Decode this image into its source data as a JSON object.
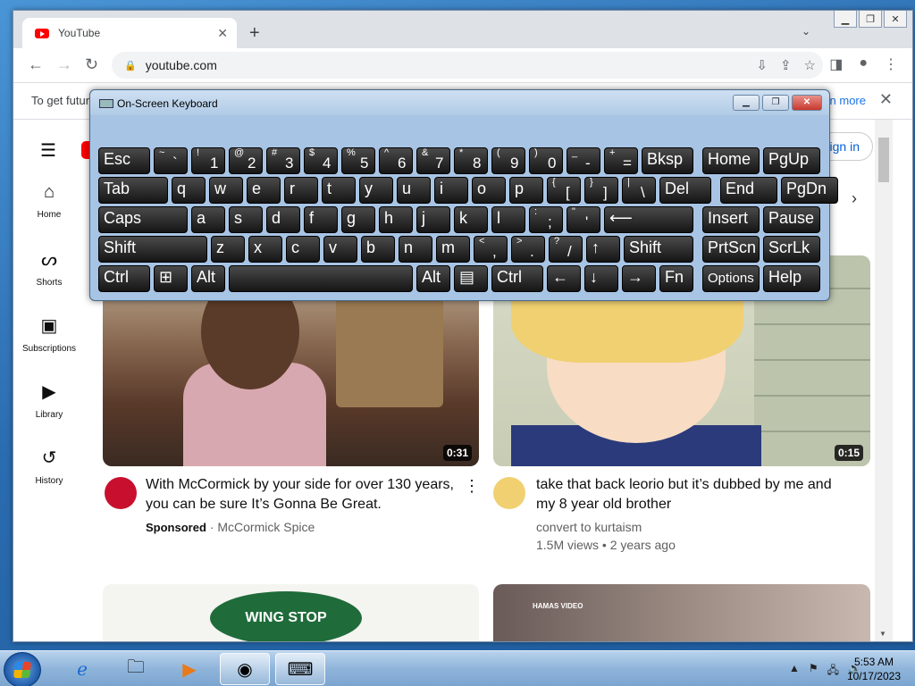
{
  "browser": {
    "tab_title": "YouTube",
    "url": "youtube.com",
    "infobar_text": "To get futur",
    "infobar_link": "n more"
  },
  "youtube": {
    "signin_label": "Sign in",
    "sidebar": [
      {
        "label": "Home",
        "icon": "home-icon"
      },
      {
        "label": "Shorts",
        "icon": "shorts-icon"
      },
      {
        "label": "Subscriptions",
        "icon": "subscriptions-icon"
      },
      {
        "label": "Library",
        "icon": "library-icon"
      },
      {
        "label": "History",
        "icon": "history-icon"
      }
    ],
    "videos": [
      {
        "title_line1": "With McCormick by your side for over 130 years,",
        "title_line2": "you can be sure It’s Gonna Be Great.",
        "sponsored": "Sponsored",
        "channel": "McCormick Spice",
        "duration": "0:31"
      },
      {
        "title_line1": "take that back leorio but it’s dubbed by me and",
        "title_line2": "my 8 year old brother",
        "channel": "convert to kurtaism",
        "meta": "1.5M views • 2 years ago",
        "duration": "0:15"
      }
    ],
    "thumb3_text": "WING STOP",
    "thumb4_text": "HAMAS VIDEO"
  },
  "osk": {
    "title": "On-Screen Keyboard",
    "rows": [
      [
        [
          "Esc",
          ""
        ],
        [
          "~",
          "`"
        ],
        [
          "!",
          "1"
        ],
        [
          "@",
          "2"
        ],
        [
          "#",
          "3"
        ],
        [
          "$",
          "4"
        ],
        [
          "%",
          "5"
        ],
        [
          "^",
          "6"
        ],
        [
          "&",
          "7"
        ],
        [
          "*",
          "8"
        ],
        [
          "(",
          "9"
        ],
        [
          ")",
          "0"
        ],
        [
          "_",
          "-"
        ],
        [
          "+",
          "="
        ],
        [
          "Bksp",
          ""
        ],
        [
          "Home",
          ""
        ],
        [
          "PgUp",
          ""
        ]
      ],
      [
        [
          "Tab",
          ""
        ],
        [
          "q",
          ""
        ],
        [
          "w",
          ""
        ],
        [
          "e",
          ""
        ],
        [
          "r",
          ""
        ],
        [
          "t",
          ""
        ],
        [
          "y",
          ""
        ],
        [
          "u",
          ""
        ],
        [
          "i",
          ""
        ],
        [
          "o",
          ""
        ],
        [
          "p",
          ""
        ],
        [
          "{",
          "["
        ],
        [
          "}",
          "]"
        ],
        [
          "|",
          "\\"
        ],
        [
          "Del",
          ""
        ],
        [
          "End",
          ""
        ],
        [
          "PgDn",
          ""
        ]
      ],
      [
        [
          "Caps",
          ""
        ],
        [
          "a",
          ""
        ],
        [
          "s",
          ""
        ],
        [
          "d",
          ""
        ],
        [
          "f",
          ""
        ],
        [
          "g",
          ""
        ],
        [
          "h",
          ""
        ],
        [
          "j",
          ""
        ],
        [
          "k",
          ""
        ],
        [
          "l",
          ""
        ],
        [
          ":",
          ";"
        ],
        [
          "\"",
          "'"
        ],
        [
          "⟵",
          ""
        ],
        [
          "Insert",
          ""
        ],
        [
          "Pause",
          ""
        ]
      ],
      [
        [
          "Shift",
          ""
        ],
        [
          "z",
          ""
        ],
        [
          "x",
          ""
        ],
        [
          "c",
          ""
        ],
        [
          "v",
          ""
        ],
        [
          "b",
          ""
        ],
        [
          "n",
          ""
        ],
        [
          "m",
          ""
        ],
        [
          "<",
          ","
        ],
        [
          ">",
          "."
        ],
        [
          "?",
          "/"
        ],
        [
          "↑",
          ""
        ],
        [
          "Shift",
          ""
        ],
        [
          "PrtScn",
          ""
        ],
        [
          "ScrLk",
          ""
        ]
      ],
      [
        [
          "Ctrl",
          ""
        ],
        [
          "⊞",
          ""
        ],
        [
          "Alt",
          ""
        ],
        [
          "",
          ""
        ],
        [
          "Alt",
          ""
        ],
        [
          "▤",
          ""
        ],
        [
          "Ctrl",
          ""
        ],
        [
          "←",
          ""
        ],
        [
          "↓",
          ""
        ],
        [
          "→",
          ""
        ],
        [
          "Fn",
          ""
        ],
        [
          "Options",
          ""
        ],
        [
          "Help",
          ""
        ]
      ]
    ]
  },
  "taskbar": {
    "time": "5:53 AM",
    "date": "10/17/2023"
  }
}
